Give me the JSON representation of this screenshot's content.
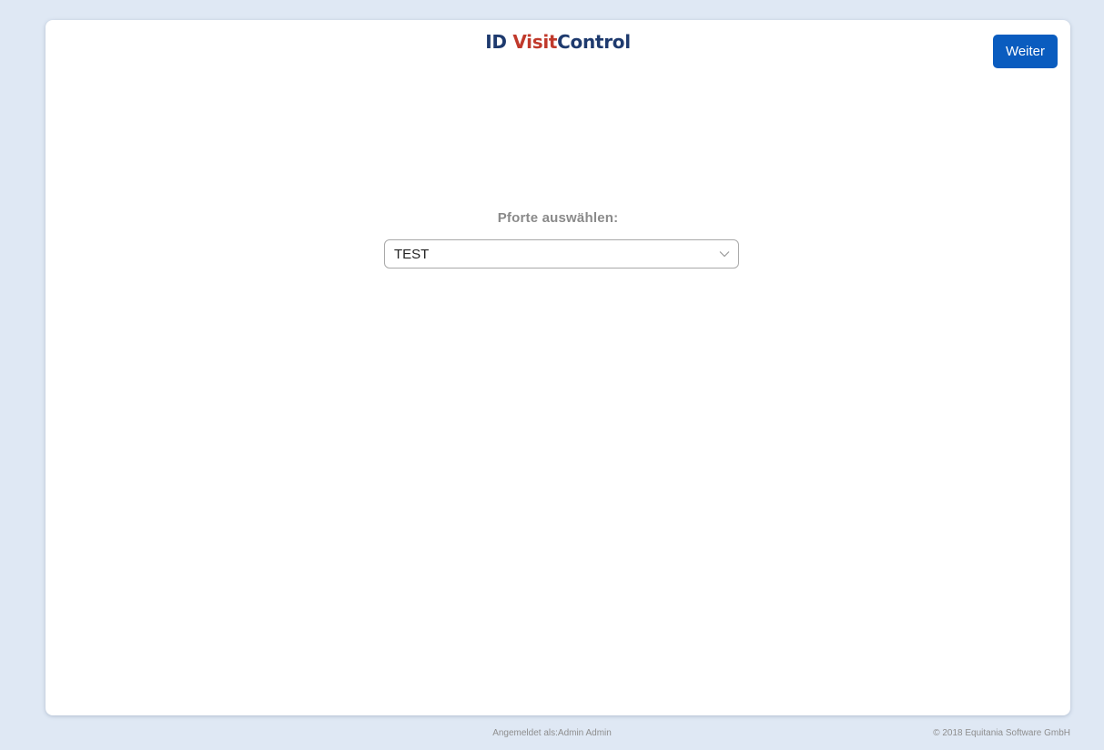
{
  "header": {
    "logo": {
      "part1": "ID ",
      "part2": "Visit",
      "part3": "Control"
    },
    "next_button": "Weiter"
  },
  "main": {
    "label": "Pforte auswählen:",
    "select": {
      "value": "TEST"
    }
  },
  "footer": {
    "logged_in": "Angemeldet als:Admin Admin",
    "copyright": "© 2018 Equitania Software GmbH"
  },
  "colors": {
    "background": "#dfe8f4",
    "primary_button": "#0a5cbf",
    "logo_blue": "#1e3a6e",
    "logo_red": "#c0392b"
  }
}
